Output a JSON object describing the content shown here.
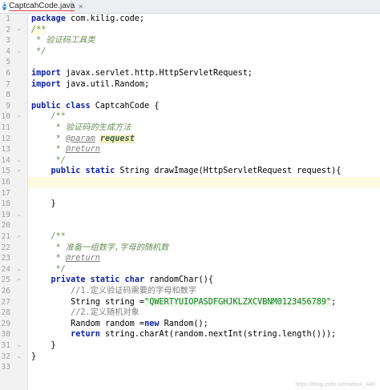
{
  "tab": {
    "label": "CaptcahCode.java",
    "icon": "C"
  },
  "lines": [
    {
      "n": "1"
    },
    {
      "n": "2"
    },
    {
      "n": "3"
    },
    {
      "n": "4"
    },
    {
      "n": "5"
    },
    {
      "n": "6"
    },
    {
      "n": "7"
    },
    {
      "n": "8"
    },
    {
      "n": "9"
    },
    {
      "n": "10"
    },
    {
      "n": "11"
    },
    {
      "n": "12"
    },
    {
      "n": "13"
    },
    {
      "n": "14"
    },
    {
      "n": "15"
    },
    {
      "n": "16"
    },
    {
      "n": "17"
    },
    {
      "n": "18"
    },
    {
      "n": "19"
    },
    {
      "n": "20"
    },
    {
      "n": "21"
    },
    {
      "n": "22"
    },
    {
      "n": "23"
    },
    {
      "n": "24"
    },
    {
      "n": "25"
    },
    {
      "n": "26"
    },
    {
      "n": "27"
    },
    {
      "n": "28"
    },
    {
      "n": "29"
    },
    {
      "n": "30"
    },
    {
      "n": "31"
    },
    {
      "n": "32"
    },
    {
      "n": "33"
    }
  ],
  "code": {
    "l1_kw": "package",
    "l1_rest": " com.kilig.code;",
    "l2": "/**",
    "l3": " * 验证码工具类",
    "l4": " */",
    "l6_kw": "import",
    "l6_rest": " javax.servlet.http.HttpServletRequest;",
    "l7_kw": "import",
    "l7_rest": " java.util.Random;",
    "l9_kw": "public class",
    "l9_rest": " CaptcahCode {",
    "l10": "    /**",
    "l11": "     * 验证码的生成方法",
    "l12_pre": "     * ",
    "l12_tag": "@param",
    "l12_sp": " ",
    "l12_param": "request",
    "l13_pre": "     * ",
    "l13_tag": "@return",
    "l14": "     */",
    "l15_pre": "    ",
    "l15_kw": "public static",
    "l15_rest": " String drawImage(HttpServletRequest request){",
    "l18": "    }",
    "l21": "    /**",
    "l22": "     * 准备一组数字,字母的随机数",
    "l23_pre": "     * ",
    "l23_tag": "@return",
    "l24": "     */",
    "l25_pre": "    ",
    "l25_kw": "private static char",
    "l25_rest": " randomChar(){",
    "l26": "        //1.定义验证码需要的字母和数字",
    "l27_pre": "        String string =",
    "l27_str": "\"QWERTYUIOPASDFGHJKLZXCVBNM0123456789\"",
    "l27_end": ";",
    "l28": "        //2.定义随机对象",
    "l29_pre": "        Random random =",
    "l29_kw": "new",
    "l29_rest": " Random();",
    "l30_pre": "        ",
    "l30_kw": "return",
    "l30_rest": " string.charAt(random.nextInt(string.length()));",
    "l31": "    }",
    "l32": "}"
  },
  "watermark": "https://blog.csdn.net/weixin_440"
}
